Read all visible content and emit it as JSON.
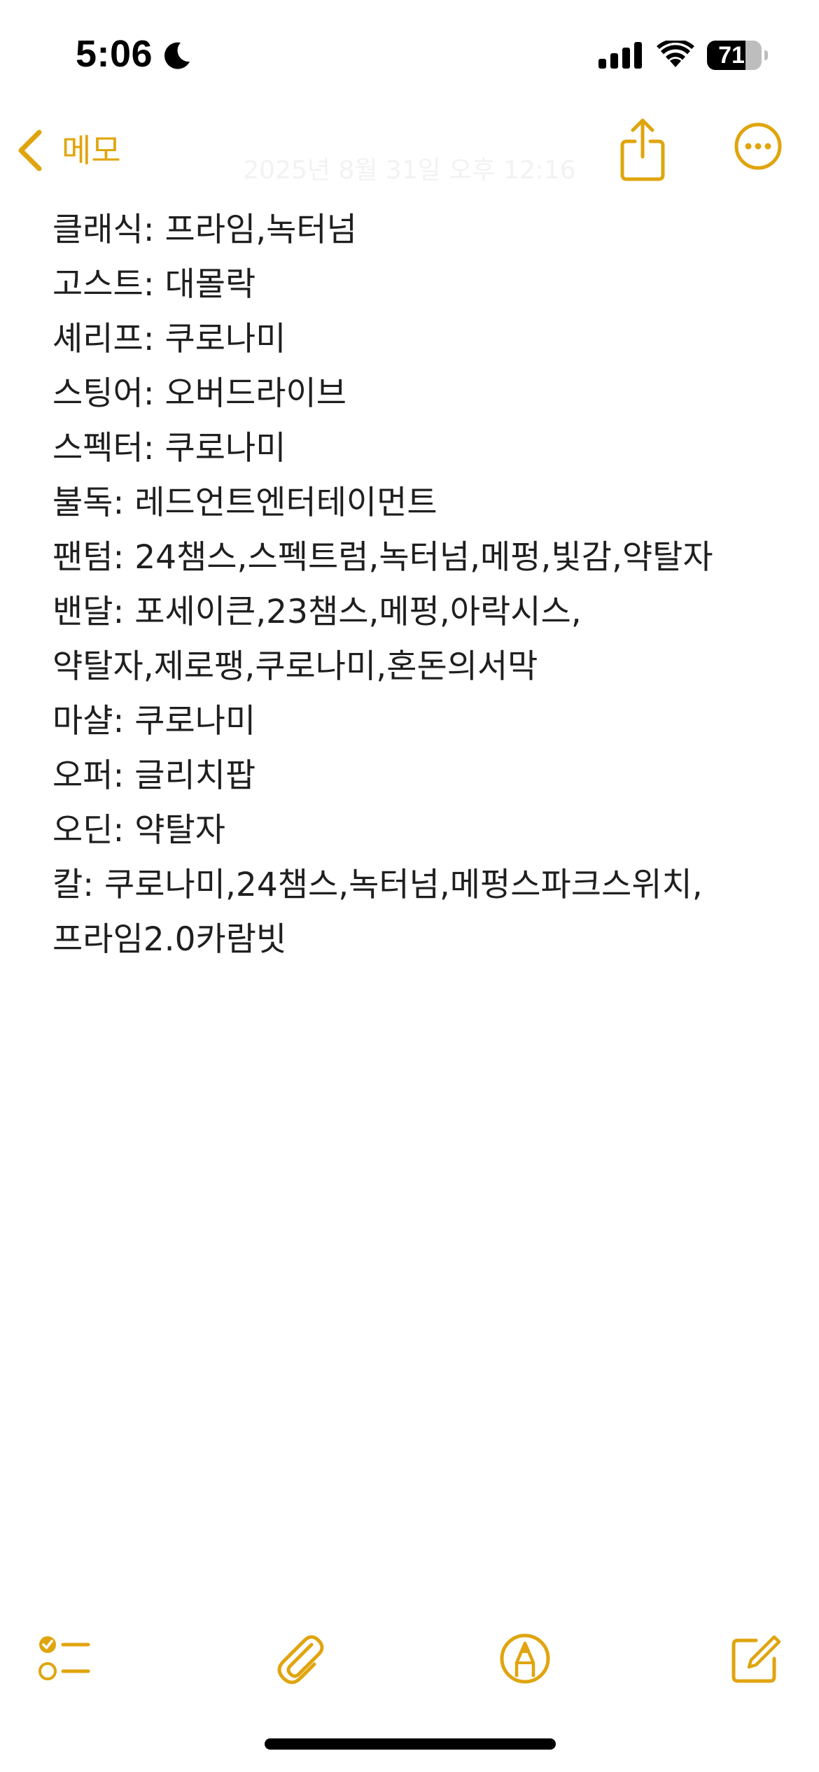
{
  "status_bar": {
    "time": "5:06",
    "battery_level": "71",
    "battery_fraction": 0.71,
    "icons": [
      "moon-icon",
      "signal-icon",
      "wifi-icon",
      "battery-icon"
    ]
  },
  "nav": {
    "back_label": "메모",
    "back_icon": "chevron-left-icon",
    "share_icon": "share-icon",
    "more_icon": "more-icon"
  },
  "note": {
    "date": "2025년 8월 31일 오후 12:16",
    "lines": [
      "클래식: 프라임,녹터넘",
      "고스트: 대몰락",
      "셰리프: 쿠로나미",
      "스팅어: 오버드라이브",
      "스펙터: 쿠로나미",
      "불독: 레드언트엔터테이먼트",
      "팬텀: 24챔스,스펙트럼,녹터넘,메펑,빛감,약탈자",
      "밴달: 포세이큰,23챔스,메펑,아락시스,",
      "약탈자,제로팽,쿠로나미,혼돈의서막",
      "마샬: 쿠로나미",
      "오퍼: 글리치팝",
      "오딘: 약탈자",
      "칼: 쿠로나미,24챔스,녹터넘,메펑스파크스위치,",
      "프라임2.0카람빗"
    ]
  },
  "toolbar": {
    "items": [
      "checklist-icon",
      "paperclip-icon",
      "markup-icon",
      "compose-icon"
    ]
  },
  "colors": {
    "accent": "#E0A50E",
    "text": "#1F1F1F",
    "background": "#FFFFFF"
  }
}
